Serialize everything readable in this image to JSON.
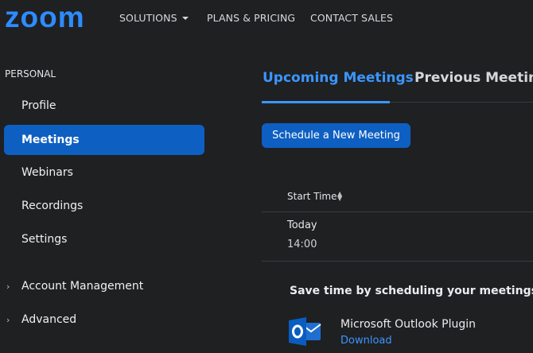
{
  "header": {
    "logo_text": "zoom",
    "nav": {
      "solutions": "SOLUTIONS",
      "plans": "PLANS & PRICING",
      "contact": "CONTACT SALES"
    }
  },
  "sidebar": {
    "section_label": "PERSONAL",
    "items": {
      "profile": "Profile",
      "meetings": "Meetings",
      "webinars": "Webinars",
      "recordings": "Recordings",
      "settings": "Settings"
    },
    "expandable": {
      "account": "Account Management",
      "advanced": "Advanced"
    }
  },
  "main": {
    "tabs": {
      "upcoming": "Upcoming Meetings",
      "previous": "Previous Meetings"
    },
    "schedule_button": "Schedule a New Meeting",
    "table": {
      "header_start_time": "Start Time",
      "rows": [
        {
          "day": "Today",
          "time": "14:00"
        }
      ]
    },
    "promo": {
      "title": "Save time by scheduling your meetings",
      "plugin_name": "Microsoft Outlook Plugin",
      "download_label": "Download"
    }
  },
  "colors": {
    "background": "#1f2022",
    "brand_blue": "#2d8cff",
    "active_blue": "#0e5fc2",
    "link_blue": "#3a96ff"
  }
}
